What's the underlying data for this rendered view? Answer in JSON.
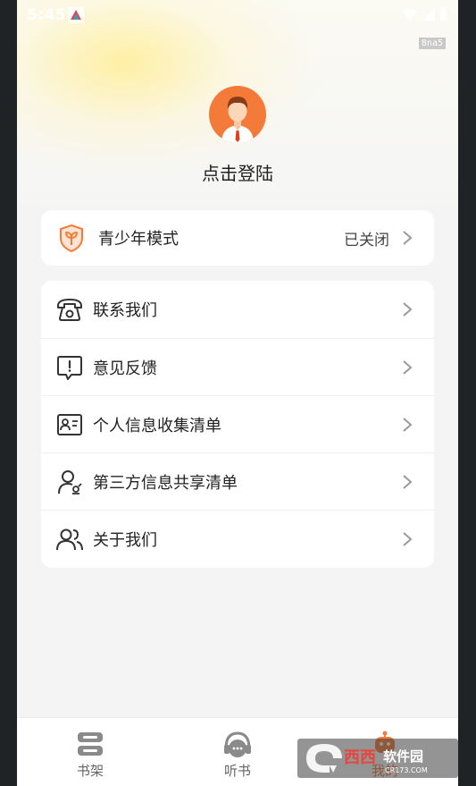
{
  "status_bar": {
    "time": "5:45",
    "debug_badge": "8na5"
  },
  "profile": {
    "login_text": "点击登陆"
  },
  "teen_mode": {
    "label": "青少年模式",
    "value": "已关闭"
  },
  "menu": {
    "items": [
      {
        "label": "联系我们",
        "icon": "telephone-icon"
      },
      {
        "label": "意见反馈",
        "icon": "feedback-icon"
      },
      {
        "label": "个人信息收集清单",
        "icon": "id-card-icon"
      },
      {
        "label": "第三方信息共享清单",
        "icon": "user-share-icon"
      },
      {
        "label": "关于我们",
        "icon": "users-icon"
      }
    ]
  },
  "tabs": [
    {
      "label": "书架",
      "icon": "bookshelf-icon"
    },
    {
      "label": "听书",
      "icon": "headphones-icon"
    },
    {
      "label": "我的",
      "icon": "robot-icon"
    }
  ],
  "watermark": {
    "text": "西西软件园",
    "sub": "CR173.COM"
  },
  "colors": {
    "accent": "#f47a3a",
    "background": "#f4f4f4",
    "card": "#ffffff"
  }
}
